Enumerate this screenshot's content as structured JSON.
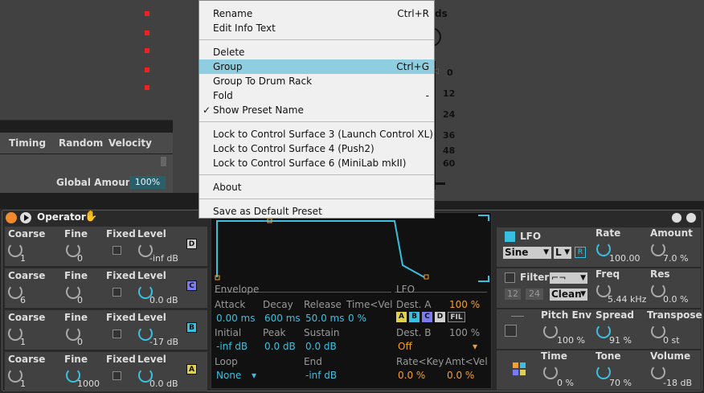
{
  "background": {
    "timing": "Timing",
    "random": "Random",
    "velocity": "Velocity",
    "global_amount_label": "Global Amount",
    "global_amount_value": "100%",
    "right_partial": "ds",
    "scale": [
      "0",
      "12",
      "24",
      "36",
      "48",
      "60"
    ],
    "scale_minus": "-"
  },
  "menu": {
    "items": [
      {
        "label": "Rename",
        "shortcut": "Ctrl+R"
      },
      {
        "label": "Edit Info Text",
        "shortcut": ""
      },
      {
        "label": "Delete",
        "shortcut": ""
      },
      {
        "label": "Group",
        "shortcut": "Ctrl+G"
      },
      {
        "label": "Group To Drum Rack",
        "shortcut": ""
      },
      {
        "label": "Fold",
        "shortcut": "-"
      },
      {
        "label": "Show Preset Name",
        "shortcut": "",
        "check": "✓"
      },
      {
        "label": "Lock to Control Surface 3 (Launch Control XL)",
        "shortcut": ""
      },
      {
        "label": "Lock to Control Surface 4 (Push2)",
        "shortcut": ""
      },
      {
        "label": "Lock to Control Surface 6 (MiniLab mkII)",
        "shortcut": ""
      },
      {
        "label": "About",
        "shortcut": ""
      },
      {
        "label": "Save as Default Preset",
        "shortcut": ""
      }
    ]
  },
  "device": {
    "title": "Operator",
    "operators": [
      {
        "coarse_label": "Coarse",
        "fine_label": "Fine",
        "fixed_label": "Fixed",
        "level_label": "Level",
        "coarse": "1",
        "fine": "0",
        "level": "-inf dB",
        "badge": "D",
        "badge_color": "#d0d0d0"
      },
      {
        "coarse_label": "Coarse",
        "fine_label": "Fine",
        "fixed_label": "Fixed",
        "level_label": "Level",
        "coarse": "6",
        "fine": "0",
        "level": "0.0 dB",
        "badge": "C",
        "badge_color": "#7c7cf0"
      },
      {
        "coarse_label": "Coarse",
        "fine_label": "Fine",
        "fixed_label": "Fixed",
        "level_label": "Level",
        "coarse": "1",
        "fine": "0",
        "level": "-17 dB",
        "badge": "B",
        "badge_color": "#39c0e0"
      },
      {
        "coarse_label": "Coarse",
        "fine_label": "Fine",
        "fixed_label": "Fixed",
        "level_label": "Level",
        "coarse": "1",
        "fine": "1000",
        "level": "0.0 dB",
        "badge": "A",
        "badge_color": "#e0d050"
      }
    ],
    "envelope": {
      "section": "Envelope",
      "attack_label": "Attack",
      "decay_label": "Decay",
      "release_label": "Release",
      "timevel_label": "Time<Vel",
      "attack": "0.00 ms",
      "decay": "600 ms",
      "release": "50.0 ms",
      "timevel": "0 %",
      "initial_label": "Initial",
      "peak_label": "Peak",
      "sustain_label": "Sustain",
      "initial": "-inf dB",
      "peak": "0.0 dB",
      "sustain": "0.0 dB",
      "loop_label": "Loop",
      "end_label": "End",
      "loop": "None",
      "end": "-inf dB"
    },
    "lfo_section": {
      "section": "LFO",
      "desta_label": "Dest. A",
      "desta_amount": "100 %",
      "destb_label": "Dest. B",
      "destb_amount": "100 %",
      "destb": "Off",
      "ratekey_label": "Rate<Key",
      "amtvel_label": "Amt<Vel",
      "ratekey": "0.0 %",
      "amtvel": "0.0 %",
      "dest_buttons": [
        "A",
        "B",
        "C",
        "D",
        "FIL"
      ]
    },
    "right": {
      "lfo_label": "LFO",
      "lfo_wave": "Sine",
      "lfo_range": "L",
      "lfo_r": "R",
      "rate_label": "Rate",
      "rate": "100.00",
      "amount_label": "Amount",
      "amount": "7.0 %",
      "filter_label": "Filter",
      "filter_12": "12",
      "filter_24": "24",
      "filter_circuit": "Clean",
      "freq_label": "Freq",
      "freq": "5.44 kHz",
      "res_label": "Res",
      "res": "0.0 %",
      "pitchenv_label": "Pitch Env",
      "pitchenv": "100 %",
      "spread_label": "Spread",
      "spread": "91 %",
      "transpose_label": "Transpose",
      "transpose": "0 st",
      "time_label": "Time",
      "time": "0 %",
      "tone_label": "Tone",
      "tone": "70 %",
      "volume_label": "Volume",
      "volume": "-18 dB"
    }
  }
}
